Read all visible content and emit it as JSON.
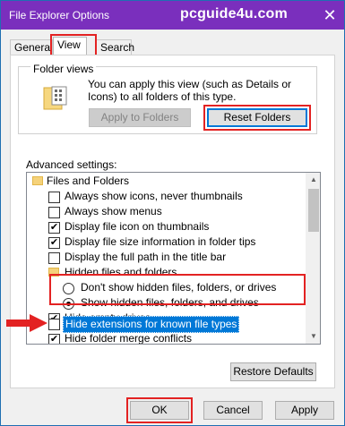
{
  "window": {
    "title": "File Explorer Options",
    "watermark": "pcguide4u.com",
    "close_glyph": "✕"
  },
  "tabs": [
    {
      "label": "General"
    },
    {
      "label": "View"
    },
    {
      "label": "Search"
    }
  ],
  "folder_views": {
    "label": "Folder views",
    "description": "You can apply this view (such as Details or Icons) to all folders of this type.",
    "apply_label": "Apply to Folders",
    "reset_label": "Reset Folders"
  },
  "advanced": {
    "label": "Advanced settings:",
    "items": [
      {
        "type": "folder",
        "label": "Files and Folders"
      },
      {
        "type": "check",
        "label": "Always show icons, never thumbnails",
        "checked": false
      },
      {
        "type": "check",
        "label": "Always show menus",
        "checked": false
      },
      {
        "type": "check",
        "label": "Display file icon on thumbnails",
        "checked": true
      },
      {
        "type": "check",
        "label": "Display file size information in folder tips",
        "checked": true
      },
      {
        "type": "check",
        "label": "Display the full path in the title bar",
        "checked": false
      },
      {
        "type": "folder",
        "label": "Hidden files and folders"
      },
      {
        "type": "radio",
        "label": "Don't show hidden files, folders, or drives",
        "checked": false
      },
      {
        "type": "radio",
        "label": "Show hidden files, folders, and drives",
        "checked": true
      },
      {
        "type": "check",
        "label": "Hide empty drives",
        "checked": true
      },
      {
        "type": "check",
        "label": "Hide extensions for known file types",
        "checked": false
      },
      {
        "type": "check",
        "label": "Hide folder merge conflicts",
        "checked": true
      }
    ],
    "restore_label": "Restore Defaults"
  },
  "footer": {
    "ok_label": "OK",
    "cancel_label": "Cancel",
    "apply_label": "Apply"
  },
  "colors": {
    "title_bar": "#7a2fbd",
    "highlight": "#e32222",
    "selection": "#0078d7"
  }
}
